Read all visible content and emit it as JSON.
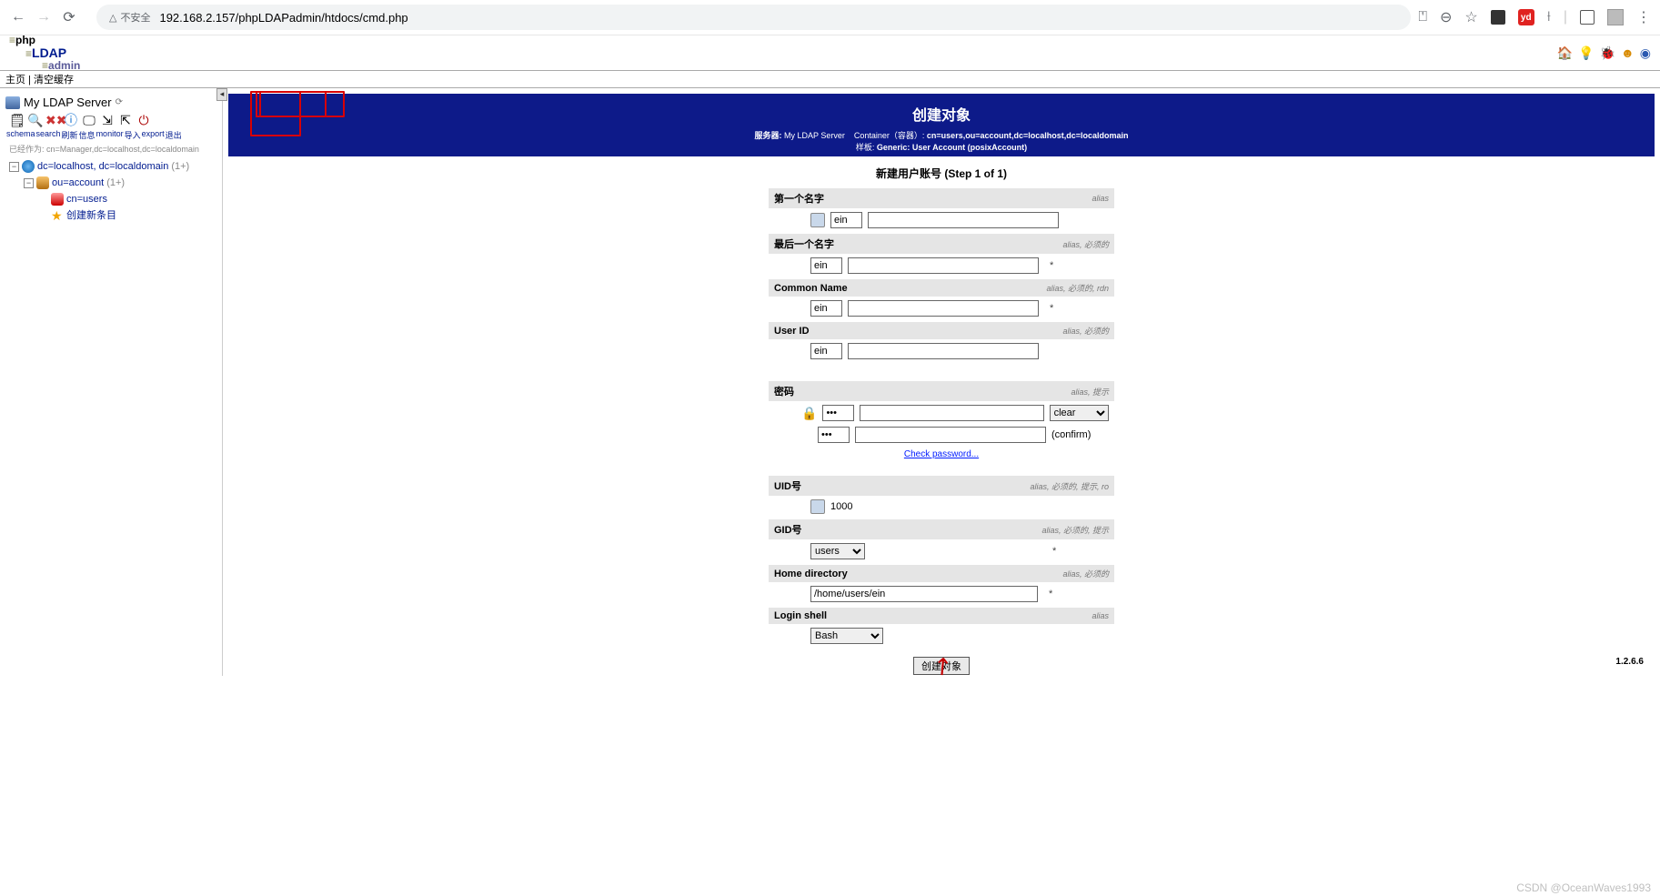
{
  "browser": {
    "insecure_label": "不安全",
    "url": "192.168.2.157/phpLDAPadmin/htdocs/cmd.php"
  },
  "logo": {
    "p1_pre": "≡",
    "p1": "php",
    "p2": "LDAP",
    "p3_pre": "≡",
    "p3": "admin"
  },
  "top_nav": {
    "home": "主页",
    "purge": "清空缓存"
  },
  "server": {
    "name": "My LDAP Server",
    "tb_labels": [
      "schema",
      "search",
      "刷新",
      "信息",
      "monitor",
      "导入",
      "export",
      "退出"
    ],
    "auth": "已经作为: cn=Manager,dc=localhost,dc=localdomain",
    "tree": {
      "root": "dc=localhost, dc=localdomain",
      "root_cnt": "(1+)",
      "l1": "ou=account",
      "l1_cnt": "(1+)",
      "l2": "cn=users",
      "l3": "创建新条目"
    }
  },
  "header": {
    "title": "创建对象",
    "meta1_lbl": "服务器:",
    "meta1_val": "My LDAP Server",
    "meta2_lbl": "Container（容器）:",
    "meta2_val": "cn=users,ou=account,dc=localhost,dc=localdomain",
    "meta3_lbl": "样板:",
    "meta3_val": "Generic: User Account (posixAccount)"
  },
  "step": "新建用户账号 (Step 1 of 1)",
  "form": {
    "first_name": {
      "label": "第一个名字",
      "meta": "alias",
      "value": "ein"
    },
    "last_name": {
      "label": "最后一个名字",
      "meta": "alias, 必须的",
      "value": "ein",
      "req": "*"
    },
    "common_name": {
      "label": "Common Name",
      "meta": "alias, 必须的, rdn",
      "value": "ein",
      "req": "*"
    },
    "user_id": {
      "label": "User ID",
      "meta": "alias, 必须的",
      "value": "ein"
    },
    "password": {
      "label": "密码",
      "meta": "alias, 提示",
      "value": "•••",
      "method": "clear",
      "confirm": "(confirm)",
      "check": "Check password..."
    },
    "uid": {
      "label": "UID号",
      "meta": "alias, 必须的, 提示, ro",
      "value": "1000"
    },
    "gid": {
      "label": "GID号",
      "meta": "alias, 必须的, 提示",
      "value": "users",
      "req": "*"
    },
    "home": {
      "label": "Home directory",
      "meta": "alias, 必须的",
      "value": "/home/users/ein",
      "req": "*"
    },
    "shell": {
      "label": "Login shell",
      "meta": "alias",
      "value": "Bash"
    },
    "submit": "创建对象"
  },
  "version": "1.2.6.6",
  "watermark": "CSDN @OceanWaves1993"
}
